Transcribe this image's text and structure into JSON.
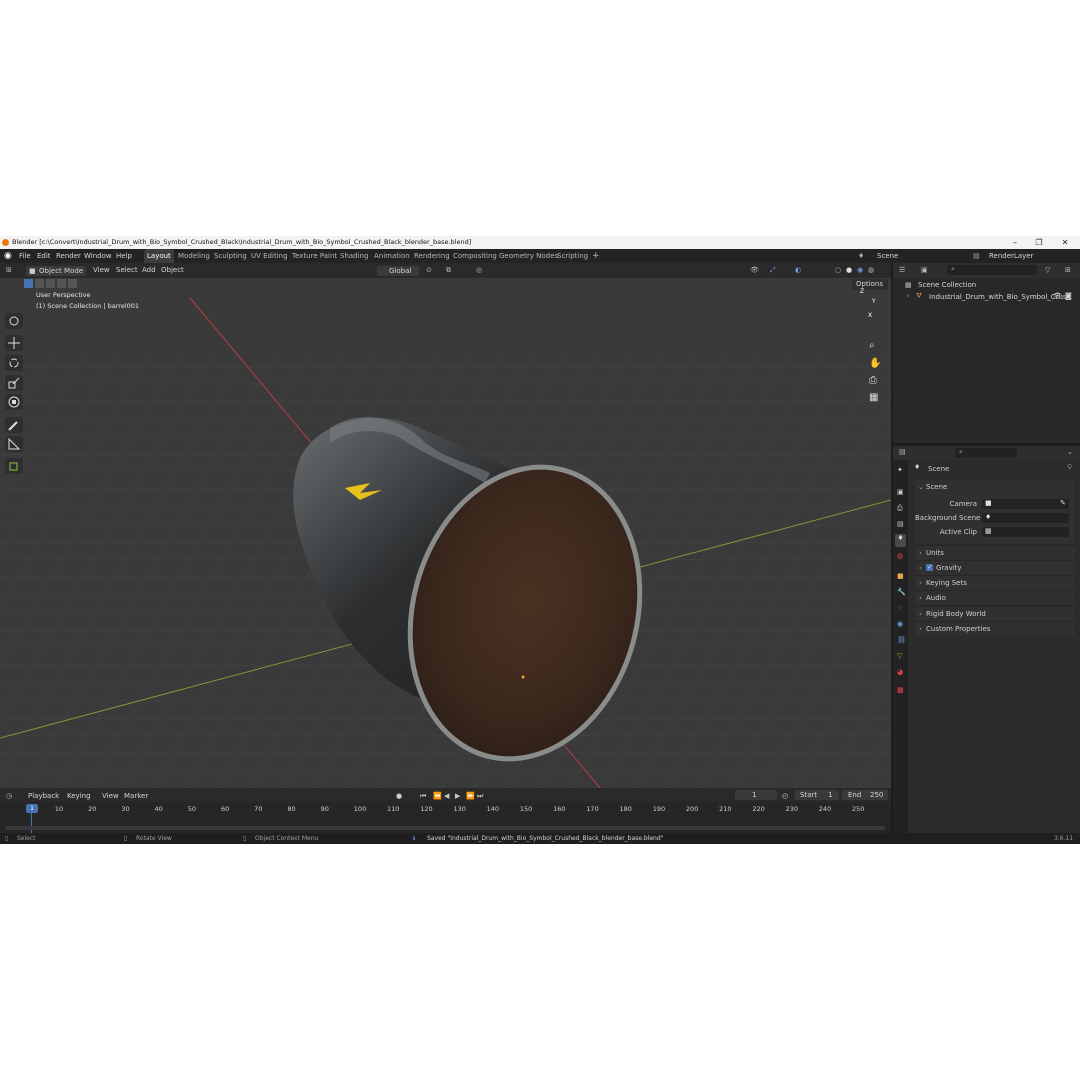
{
  "window": {
    "title": "Blender [c:\\Convert\\Industrial_Drum_with_Bio_Symbol_Crushed_Black\\Industrial_Drum_with_Bio_Symbol_Crushed_Black_blender_base.blend]",
    "minimize": "–",
    "maximize": "❐",
    "close": "✕"
  },
  "menu": [
    "File",
    "Edit",
    "Render",
    "Window",
    "Help"
  ],
  "workspaces": [
    "Layout",
    "Modeling",
    "Sculpting",
    "UV Editing",
    "Texture Paint",
    "Shading",
    "Animation",
    "Rendering",
    "Compositing",
    "Geometry Nodes",
    "Scripting"
  ],
  "workspace_add": "+",
  "scene_selector": "Scene",
  "view_layer_selector": "RenderLayer",
  "viewport_header": {
    "mode": "Object Mode",
    "menus": [
      "View",
      "Select",
      "Add",
      "Object"
    ],
    "orientation": "Global",
    "options": "Options"
  },
  "viewport": {
    "perspective_label": "User Perspective",
    "collection_label": "(1) Scene Collection | barrel001",
    "gizmo_axes": [
      "Z",
      "Y",
      "X"
    ]
  },
  "timeline": {
    "menus": [
      "Playback",
      "Keying",
      "View",
      "Marker"
    ],
    "current_frame": "1",
    "start_label": "Start",
    "start_value": "1",
    "end_label": "End",
    "end_value": "250",
    "frame_marker": "1",
    "ticks": [
      "10",
      "20",
      "30",
      "40",
      "50",
      "60",
      "70",
      "80",
      "90",
      "100",
      "110",
      "120",
      "130",
      "140",
      "150",
      "160",
      "170",
      "180",
      "190",
      "200",
      "210",
      "220",
      "230",
      "240",
      "250"
    ]
  },
  "outliner": {
    "root": "Scene Collection",
    "item": "Industrial_Drum_with_Bio_Symbol_Crus"
  },
  "properties": {
    "context": "Scene",
    "panel": "Scene",
    "camera_label": "Camera",
    "background_scene_label": "Background Scene",
    "active_clip_label": "Active Clip",
    "sections": [
      "Units",
      "Gravity",
      "Keying Sets",
      "Audio",
      "Rigid Body World",
      "Custom Properties"
    ]
  },
  "statusbar": {
    "select": "Select",
    "rotate": "Rotate View",
    "context_menu": "Object Context Menu",
    "message": "Saved \"Industrial_Drum_with_Bio_Symbol_Crushed_Black_blender_base.blend\"",
    "version": "3.6.11"
  },
  "colors": {
    "accent": "#4772b3",
    "x_axis": "#e2434f",
    "y_axis": "#8cc63f",
    "z_axis": "#3b7de0"
  }
}
